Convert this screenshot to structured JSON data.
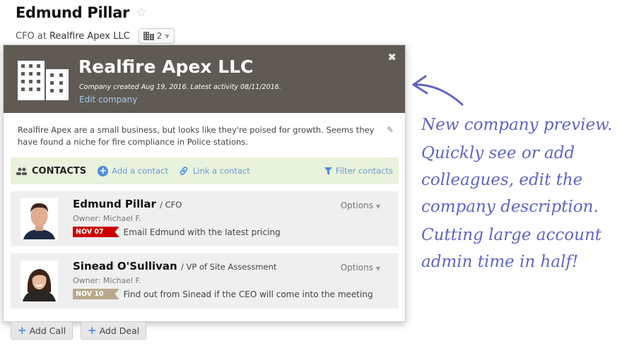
{
  "person": {
    "name": "Edmund Pillar",
    "role_prefix": "CFO at",
    "company": "Realfire Apex LLC",
    "companies_count": "2"
  },
  "popover": {
    "company_name": "Realfire Apex LLC",
    "created_text": "Company created Aug 19, 2016. Latest activity 08/11/2016.",
    "edit_link": "Edit company",
    "description": "Realfire Apex are a small business, but looks like they're poised for growth. Seems they have found a niche for fire compliance in Police stations.",
    "contacts_bar": {
      "label": "CONTACTS",
      "add_link": "Add a contact",
      "link_link": "Link a contact",
      "filter_link": "Filter contacts"
    },
    "contacts": [
      {
        "name": "Edmund Pillar",
        "title": "/ CFO",
        "owner": "Owner: Michael F.",
        "date": "NOV 07",
        "date_color": "#cc0000",
        "task": "Email Edmund with the latest pricing",
        "options": "Options"
      },
      {
        "name": "Sinead O'Sullivan",
        "title": "/ VP of Site Assessment",
        "owner": "Owner: Michael F.",
        "date": "NOV 10",
        "date_color": "#b9a98c",
        "task": "Find out from Sinead if the CEO will come into the meeting",
        "options": "Options"
      }
    ]
  },
  "buttons": {
    "add_call": "Add Call",
    "add_deal": "Add Deal"
  },
  "annotation": {
    "line1": "New company preview.",
    "line2": "Quickly see or add colleagues, edit the company description.",
    "line3": "Cutting large account admin time in half!"
  }
}
